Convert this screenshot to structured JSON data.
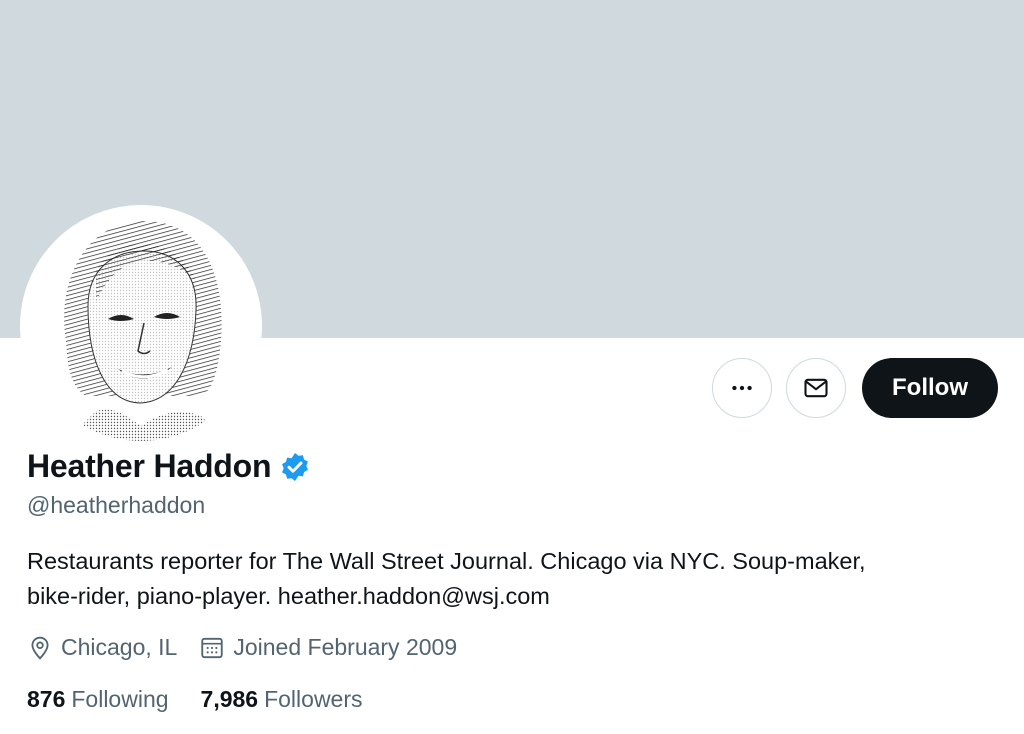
{
  "profile": {
    "name": "Heather Haddon",
    "handle": "@heatherhaddon",
    "bio_line1": "Restaurants reporter for The Wall Street Journal. Chicago via NYC. Soup-maker,",
    "bio_line2": "bike-rider, piano-player. heather.haddon@wsj.com",
    "location": "Chicago, IL",
    "joined": "Joined February 2009",
    "verified": true
  },
  "actions": {
    "more_icon": "more-horizontal-icon",
    "message_icon": "envelope-icon",
    "follow_label": "Follow"
  },
  "stats": {
    "following_count": "876",
    "following_label": "Following",
    "followers_count": "7,986",
    "followers_label": "Followers"
  },
  "colors": {
    "banner": "#cfd9de",
    "verified_badge": "#1d9bf0",
    "follow_button": "#0f1419",
    "secondary_text": "#536471"
  }
}
